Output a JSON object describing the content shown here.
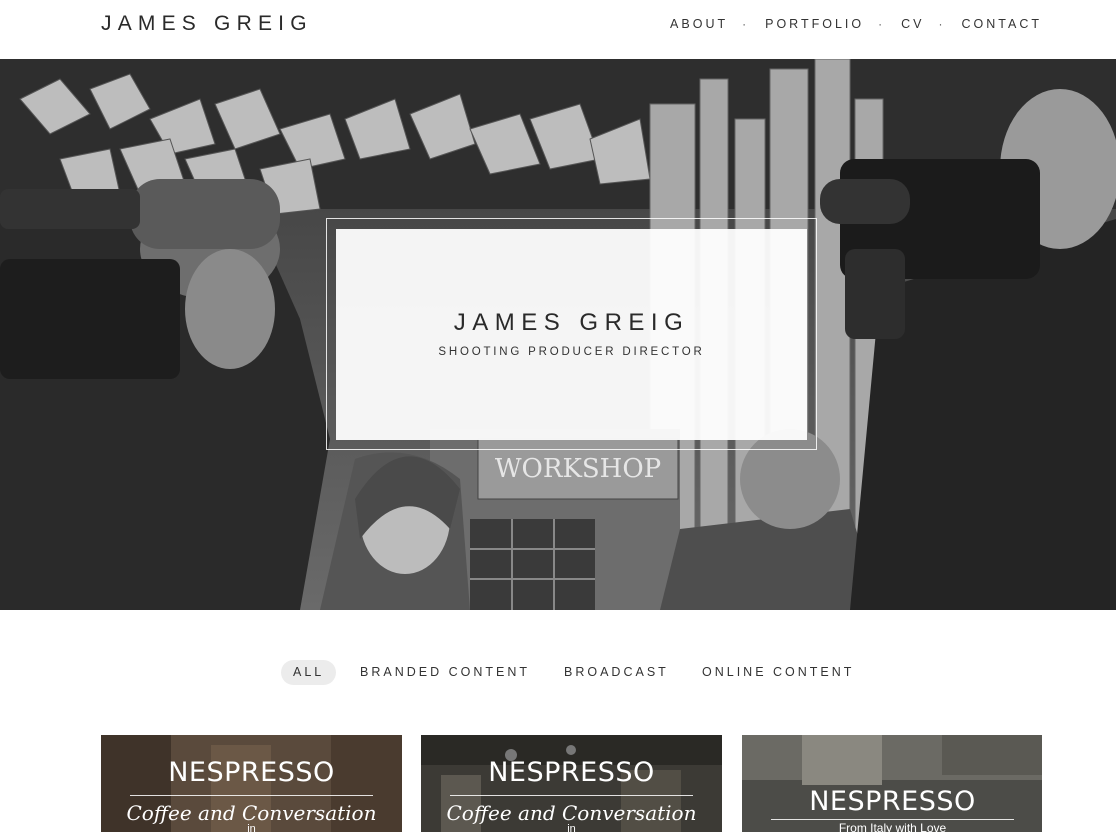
{
  "header": {
    "logo": "JAMES GREIG",
    "nav": [
      "ABOUT",
      "PORTFOLIO",
      "CV",
      "CONTACT"
    ],
    "separator": "·"
  },
  "hero": {
    "title": "JAMES GREIG",
    "subtitle": "SHOOTING PRODUCER DIRECTOR",
    "sign_text": "WORKSHOP"
  },
  "filters": [
    "ALL",
    "BRANDED CONTENT",
    "BROADCAST",
    "ONLINE CONTENT"
  ],
  "cards": [
    {
      "brand": "NESPRESSO",
      "sub": "Coffee and Conversation",
      "small": "in"
    },
    {
      "brand": "NESPRESSO",
      "sub": "Coffee and Conversation",
      "small": "in"
    },
    {
      "brand": "NESPRESSO",
      "sub": "From Italy with Love",
      "small": ""
    }
  ],
  "colors": {
    "accent": "#2a2a2a",
    "active_filter_bg": "#ececec"
  }
}
